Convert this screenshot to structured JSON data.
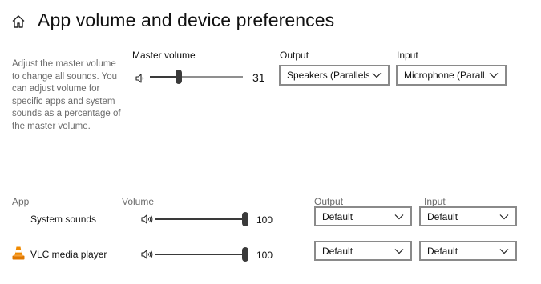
{
  "header": {
    "title": "App volume and device preferences"
  },
  "description": "Adjust the master volume to change all sounds. You can adjust volume for specific apps and system sounds as a percentage of the master volume.",
  "master": {
    "label": "Master volume",
    "value": "31",
    "level": 0.31
  },
  "output": {
    "label": "Output",
    "selected": "Speakers (Parallels..."
  },
  "input": {
    "label": "Input",
    "selected": "Microphone (Parall..."
  },
  "apps_table": {
    "headers": {
      "app": "App",
      "volume": "Volume",
      "output": "Output",
      "input": "Input"
    },
    "rows": [
      {
        "name": "System sounds",
        "volume": "100",
        "level": 1.0,
        "output": "Default",
        "input": "Default",
        "icon": "none"
      },
      {
        "name": "VLC media player",
        "volume": "100",
        "level": 1.0,
        "output": "Default",
        "input": "Default",
        "icon": "vlc-cone-icon"
      }
    ]
  },
  "icons": {
    "home": "home-icon",
    "speaker_low": "speaker-low-icon",
    "speaker_high": "speaker-high-icon",
    "chevron": "chevron-down-icon"
  },
  "colors": {
    "slider": "#3a3a3a",
    "vlc_orange": "#f08a00"
  }
}
